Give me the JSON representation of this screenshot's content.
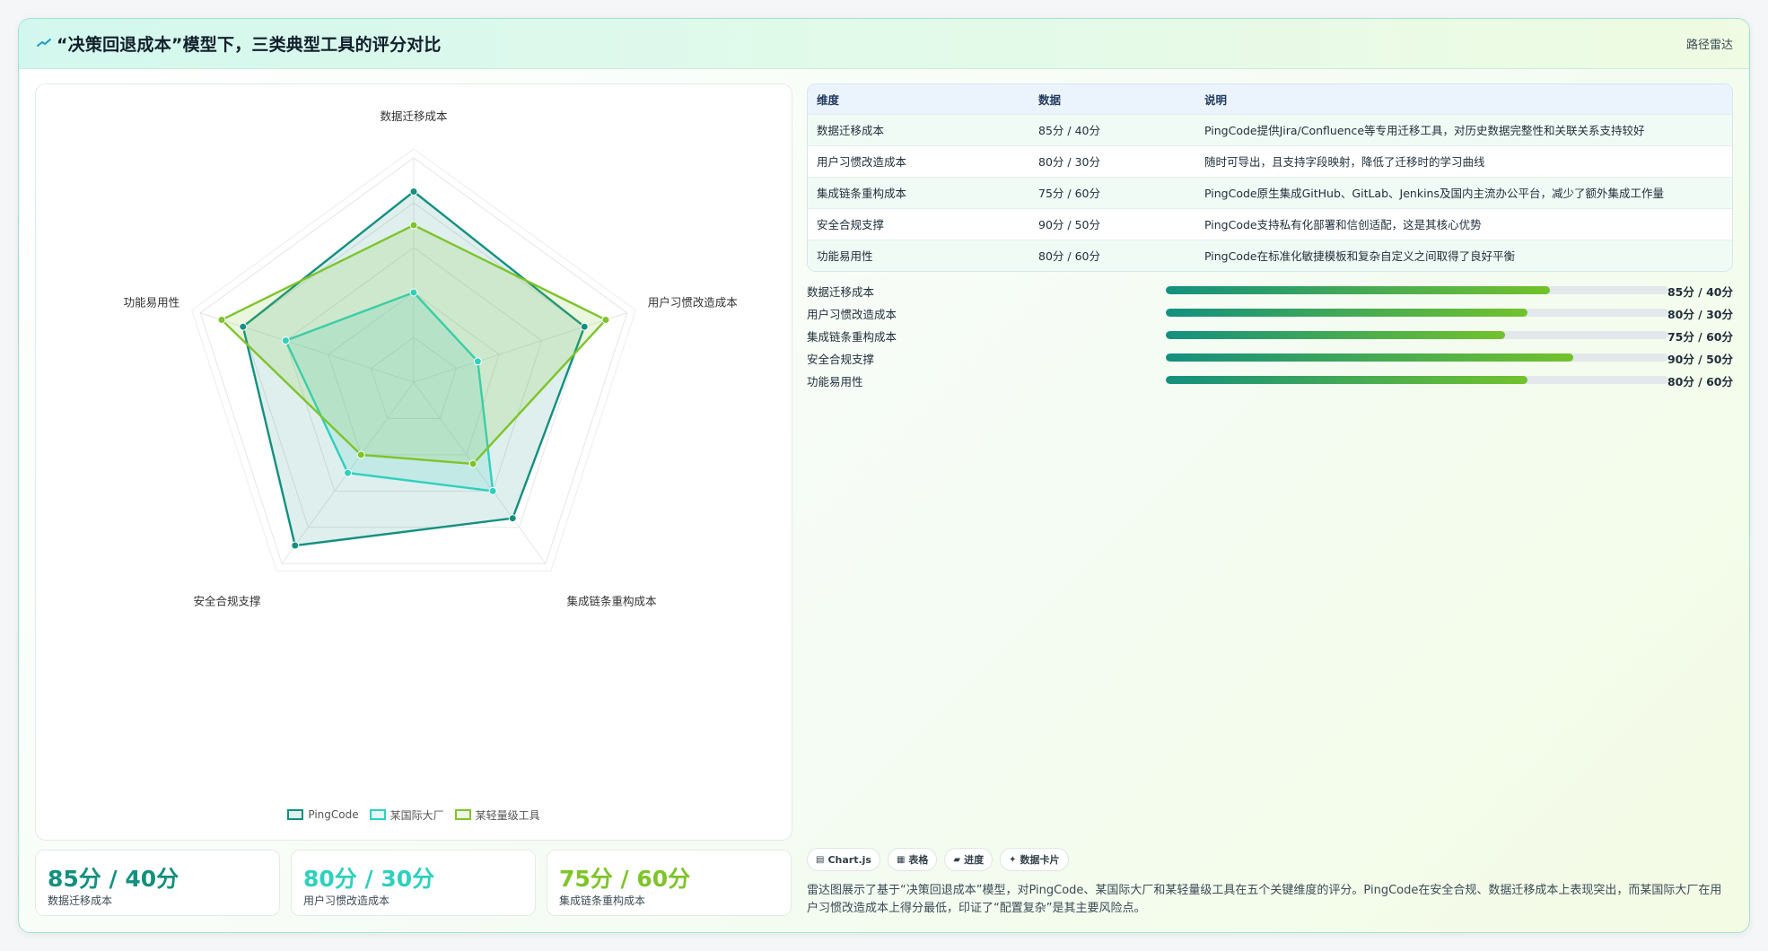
{
  "header": {
    "title": "“决策回退成本”模型下，三类典型工具的评分对比",
    "tag": "路径雷达"
  },
  "colors": {
    "pingcode": "#13907f",
    "intl": "#2fd0be",
    "light": "#7ec42a"
  },
  "chart_data": {
    "type": "radar",
    "axes": [
      "数据迁移成本",
      "用户习惯改造成本",
      "集成链条重构成本",
      "安全合规支撑",
      "功能易用性"
    ],
    "range": [
      0,
      100
    ],
    "series": [
      {
        "name": "PingCode",
        "values": [
          85,
          80,
          75,
          90,
          80
        ],
        "color": "#13907f"
      },
      {
        "name": "某国际大厂",
        "values": [
          40,
          30,
          60,
          50,
          60
        ],
        "color": "#2fd0be"
      },
      {
        "name": "某轻量级工具",
        "values": [
          70,
          90,
          45,
          40,
          90
        ],
        "color": "#7ec42a"
      }
    ],
    "grid": true,
    "legend": "bottom"
  },
  "stats": [
    {
      "value": "85分 / 40分",
      "label": "数据迁移成本",
      "color": "#13907f"
    },
    {
      "value": "80分 / 30分",
      "label": "用户习惯改造成本",
      "color": "#2fd0be"
    },
    {
      "value": "75分 / 60分",
      "label": "集成链条重构成本",
      "color": "#7ec42a"
    }
  ],
  "table": {
    "headers": [
      "维度",
      "数据",
      "说明"
    ],
    "rows": [
      [
        "数据迁移成本",
        "85分 / 40分",
        "PingCode提供Jira/Confluence等专用迁移工具，对历史数据完整性和关联关系支持较好"
      ],
      [
        "用户习惯改造成本",
        "80分 / 30分",
        "随时可导出，且支持字段映射，降低了迁移时的学习曲线"
      ],
      [
        "集成链条重构成本",
        "75分 / 60分",
        "PingCode原生集成GitHub、GitLab、Jenkins及国内主流办公平台，减少了额外集成工作量"
      ],
      [
        "安全合规支撑",
        "90分 / 50分",
        "PingCode支持私有化部署和信创适配，这是其核心优势"
      ],
      [
        "功能易用性",
        "80分 / 60分",
        "PingCode在标准化敏捷模板和复杂自定义之间取得了良好平衡"
      ]
    ]
  },
  "bars": [
    {
      "label": "数据迁移成本",
      "value_text": "85分 / 40分",
      "fraction": 0.765
    },
    {
      "label": "用户习惯改造成本",
      "value_text": "80分 / 30分",
      "fraction": 0.72
    },
    {
      "label": "集成链条重构成本",
      "value_text": "75分 / 60分",
      "fraction": 0.675
    },
    {
      "label": "安全合规支撑",
      "value_text": "90分 / 50分",
      "fraction": 0.81
    },
    {
      "label": "功能易用性",
      "value_text": "80分 / 60分",
      "fraction": 0.72
    }
  ],
  "chips": [
    {
      "icon": "▤",
      "label": "Chart.js"
    },
    {
      "icon": "▦",
      "label": "表格"
    },
    {
      "icon": "▰",
      "label": "进度"
    },
    {
      "icon": "✦",
      "label": "数据卡片"
    }
  ],
  "summary": "雷达图展示了基于“决策回退成本”模型，对PingCode、某国际大厂和某轻量级工具在五个关键维度的评分。PingCode在安全合规、数据迁移成本上表现突出，而某国际大厂在用户习惯改造成本上得分最低，印证了“配置复杂”是其主要风险点。"
}
